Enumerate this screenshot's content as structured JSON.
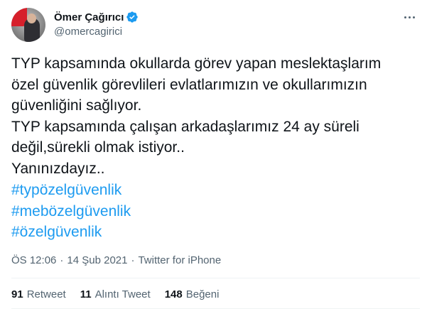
{
  "author": {
    "display_name": "Ömer Çağırıcı",
    "handle": "@omercagirici",
    "verified": true,
    "avatar_icon": "profile-avatar"
  },
  "tweet": {
    "text": "TYP kapsamında okullarda görev yapan meslektaşlarım\nözel güvenlik görevlileri evlatlarımızın ve okullarımızın\ngüvenliğini sağlıyor.\nTYP kapsamında çalışan arkadaşlarımız 24 ay süreli\ndeğil,sürekli olmak istiyor..\nYanınızdayız..",
    "hashtags": [
      "#typözelgüvenlik",
      "#mebözelgüvenlik",
      "#özelgüvenlik"
    ]
  },
  "meta": {
    "time": "ÖS 12:06",
    "separator": "·",
    "date": "14 Şub 2021",
    "source": "Twitter for iPhone"
  },
  "stats": {
    "retweets": {
      "count": "91",
      "label": "Retweet"
    },
    "quotes": {
      "count": "11",
      "label": "Alıntı Tweet"
    },
    "likes": {
      "count": "148",
      "label": "Beğeni"
    }
  },
  "colors": {
    "link": "#1d9bf0",
    "secondary_text": "#536471",
    "verified_badge": "#1d9bf0"
  }
}
